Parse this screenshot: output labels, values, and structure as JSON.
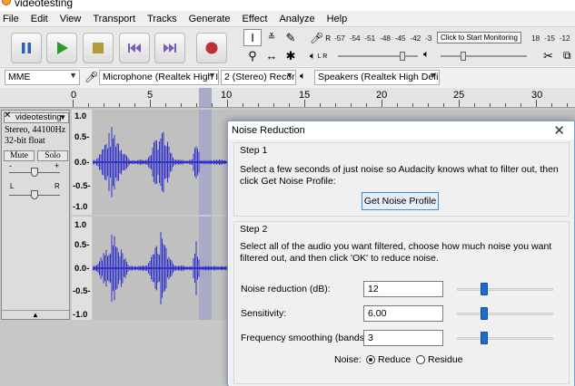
{
  "window": {
    "title": "videotesting"
  },
  "menu": [
    "File",
    "Edit",
    "View",
    "Transport",
    "Tracks",
    "Generate",
    "Effect",
    "Analyze",
    "Help"
  ],
  "toolbar": {
    "transport_icons": [
      "pause-icon",
      "play-icon",
      "stop-icon",
      "skip-start-icon",
      "skip-end-icon",
      "record-icon"
    ],
    "meter_scale": [
      "-57",
      "-54",
      "-51",
      "-48",
      "-45",
      "-42",
      "-3"
    ],
    "monitor_label": "Click to Start Monitoring",
    "meter_scale_right": [
      "18",
      "-15",
      "-12"
    ],
    "record_meter_label": "R",
    "playback_meter_label": "L R"
  },
  "devices": {
    "host": "MME",
    "input": "Microphone (Realtek High I",
    "channels": "2 (Stereo) Recor",
    "output": "Speakers (Realtek High Defi"
  },
  "ruler": {
    "labels": [
      "0",
      "5",
      "10",
      "15",
      "20",
      "25",
      "30"
    ]
  },
  "track": {
    "name": "videotesting",
    "info_line1": "Stereo, 44100Hz",
    "info_line2": "32-bit float",
    "mute_label": "Mute",
    "solo_label": "Solo",
    "pan_left": "L",
    "pan_right": "R",
    "gain_minus": "-",
    "gain_plus": "+",
    "scale_labels": [
      "1.0",
      "0.5-",
      "0.0-",
      "-0.5-",
      "-1.0",
      "1.0",
      "0.5-",
      "0.0-",
      "-0.5-",
      "-1.0"
    ]
  },
  "dialog": {
    "title": "Noise Reduction",
    "step1_label": "Step 1",
    "step1_text": "Select a few seconds of just noise so Audacity knows what to filter out, then click Get Noise Profile:",
    "profile_button": "Get Noise Profile",
    "step2_label": "Step 2",
    "step2_text": "Select all of the audio you want filtered, choose how much noise you want filtered out, and then click 'OK' to reduce noise.",
    "fields": [
      {
        "label": "Noise reduction (dB):",
        "value": "12",
        "slider_fraction": 0.27
      },
      {
        "label": "Sensitivity:",
        "value": "6.00",
        "slider_fraction": 0.27
      },
      {
        "label": "Frequency smoothing (bands):",
        "value": "3",
        "slider_fraction": 0.27
      }
    ],
    "noise_label": "Noise:",
    "noise_options": [
      "Reduce",
      "Residue"
    ],
    "noise_selected": "Reduce"
  },
  "colors": {
    "waveform": "#3232c8",
    "selection": "#a9a9c8",
    "record": "#c03030",
    "play": "#2d9a2d",
    "slider_thumb": "#1e6bd0"
  }
}
